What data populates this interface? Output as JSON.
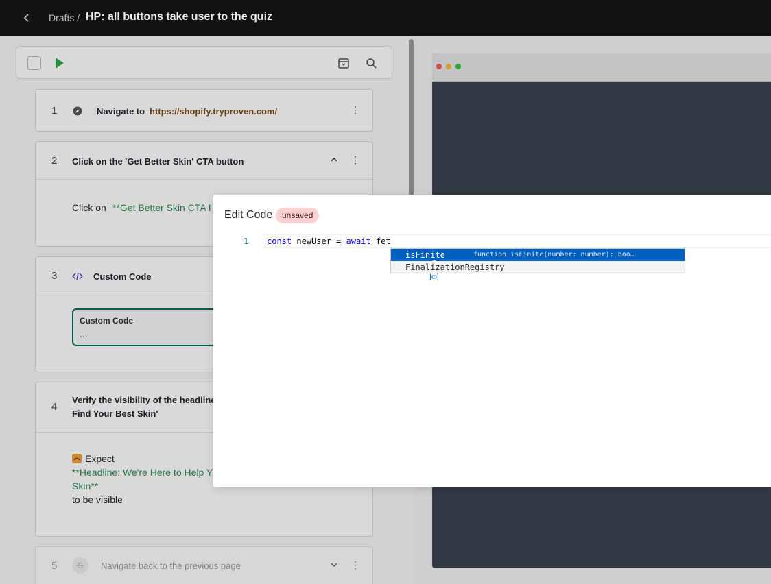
{
  "topbar": {
    "back_icon": "chevron-left-icon",
    "breadcrumb": "Drafts /",
    "title": "HP: all buttons take user to the quiz"
  },
  "toolbar": {
    "play_icon": "play-icon",
    "archive_icon": "archive-icon",
    "search_icon": "search-icon"
  },
  "steps": [
    {
      "number": "1",
      "icon": "compass-icon",
      "label": "Navigate to",
      "url": "https://shopify.tryproven.com/"
    },
    {
      "number": "2",
      "title": "Click on the 'Get Better Skin' CTA button",
      "body_prefix": "Click on",
      "body_target": "**Get Better Skin CTA I"
    },
    {
      "number": "3",
      "icon": "code-icon",
      "title": "Custom Code",
      "box_title": "Custom Code",
      "box_value": "..."
    },
    {
      "number": "4",
      "title_line1": "Verify the visibility of the headline",
      "title_line2": "Find Your Best Skin'",
      "expect_icon": "expect-emoji-icon",
      "expect_label": "Expect",
      "target_line1": "**Headline: We're Here to Help Y",
      "target_line2": "Skin**",
      "suffix": "to be visible"
    },
    {
      "number": "5",
      "icon": "skip-icon",
      "title": "Navigate back to the previous page"
    }
  ],
  "modal": {
    "title": "Edit Code",
    "badge": "unsaved",
    "line_number": "1",
    "code_kw1": "const",
    "code_mid": " newUser = ",
    "code_kw2": "await",
    "code_tail": " fet",
    "suggestions": [
      {
        "icon": "cube-icon",
        "label": "isFinite",
        "detail": "function isFinite(number: number): boo…"
      },
      {
        "icon": "variable-icon",
        "label": "FinalizationRegistry"
      }
    ]
  },
  "colors": {
    "topbar": "#141210",
    "accent_green": "#2f8a56",
    "badge_bg": "#fbd1d1",
    "selection": "#0060c0"
  }
}
